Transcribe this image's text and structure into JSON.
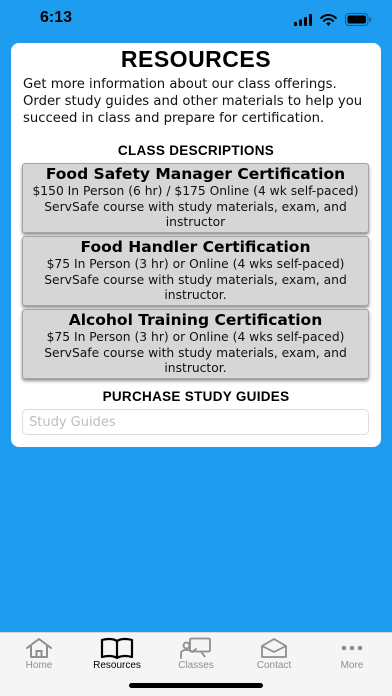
{
  "status_bar": {
    "time": "6:13"
  },
  "page": {
    "title": "RESOURCES",
    "intro": "Get more information about our class offerings. Order study guides and other materials to help you succeed in class and prepare for certification."
  },
  "class_descriptions": {
    "heading": "CLASS DESCRIPTIONS",
    "items": [
      {
        "title": "Food Safety Manager Certification",
        "description": "$150 In Person (6 hr) / $175 Online (4 wk self-paced) ServSafe course with study materials, exam, and instructor"
      },
      {
        "title": "Food Handler Certification",
        "description": "$75 In Person (3 hr) or Online (4 wks self-paced) ServSafe course with study materials, exam, and instructor."
      },
      {
        "title": "Alcohol Training Certification",
        "description": "$75 In Person (3 hr) or Online (4 wks self-paced) ServSafe course with study materials, exam, and instructor."
      }
    ]
  },
  "study_guides": {
    "heading": "PURCHASE STUDY GUIDES",
    "placeholder": "Study Guides"
  },
  "tab_bar": {
    "active": "Resources",
    "tabs": [
      {
        "label": "Home",
        "icon": "home-icon"
      },
      {
        "label": "Resources",
        "icon": "book-icon"
      },
      {
        "label": "Classes",
        "icon": "classes-icon"
      },
      {
        "label": "Contact",
        "icon": "mail-icon"
      },
      {
        "label": "More",
        "icon": "more-icon"
      }
    ]
  },
  "colors": {
    "background": "#1E9CEF",
    "card": "#FFFFFF",
    "class_card": "#D6D6D6",
    "tab_inactive": "#8E8E93",
    "tab_active": "#000000"
  }
}
